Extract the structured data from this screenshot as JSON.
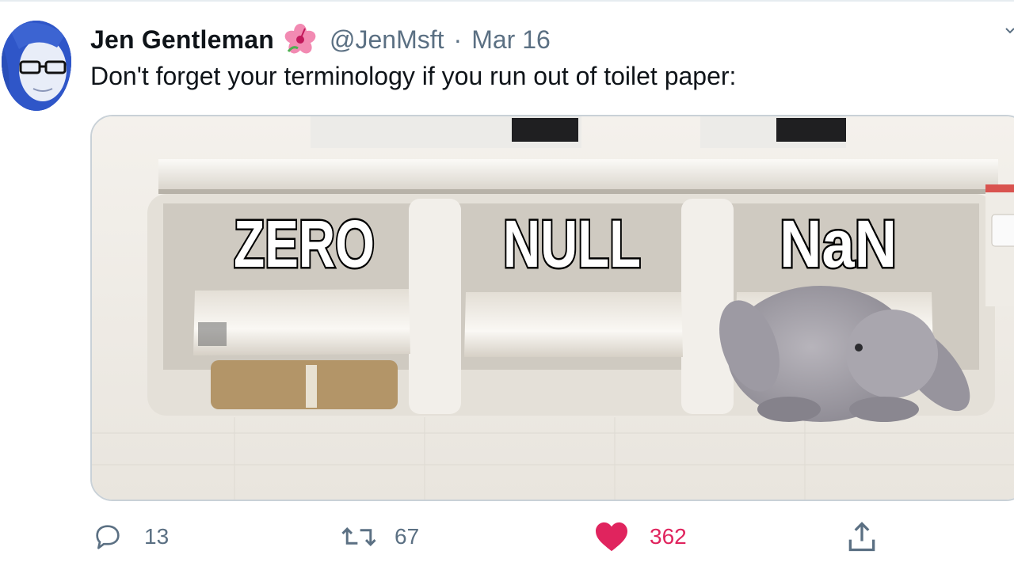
{
  "tweet": {
    "author_name": "Jen Gentleman",
    "handle": "@JenMsft",
    "separator": "·",
    "date": "Mar 16",
    "text": "Don't forget your terminology if you run out of toilet paper:"
  },
  "media": {
    "labels": [
      "ZERO",
      "NULL",
      "NaN"
    ]
  },
  "actions": {
    "replies": "13",
    "retweets": "67",
    "likes": "362"
  },
  "colors": {
    "secondary_text": "#5b7083",
    "like_red": "#e0245e",
    "avatar_blue": "#2f56c8"
  },
  "icons": {
    "reply": "reply-icon",
    "retweet": "retweet-icon",
    "like": "heart-icon",
    "share": "share-icon",
    "emoji": "hibiscus-icon"
  }
}
